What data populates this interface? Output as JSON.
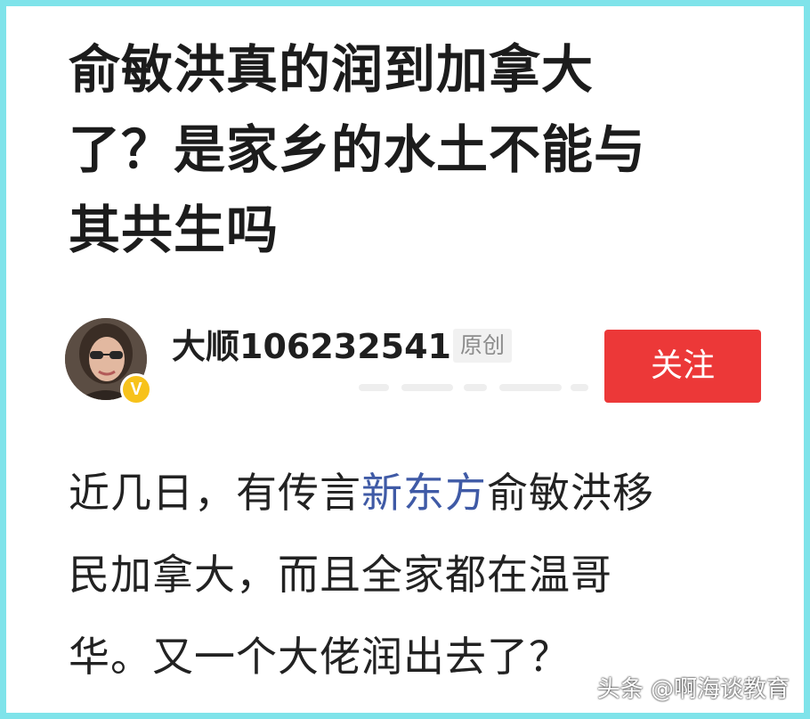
{
  "article": {
    "title_line1": "俞敏洪真的润到加拿大",
    "title_line2": "了？是家乡的水土不能与",
    "title_line3": "其共生吗"
  },
  "author": {
    "name": "大顺106232541",
    "original_label": "原创",
    "verified_mark": "V",
    "follow_label": "关注"
  },
  "content": {
    "line1_prefix": "近几日，有传言",
    "line1_link": "新东方",
    "line1_suffix": "俞敏洪移",
    "line2": "民加拿大，而且全家都在温哥",
    "line3": "华。又一个大佬润出去了？"
  },
  "watermark": {
    "text": "头条 @啊海谈教育"
  },
  "colors": {
    "border": "#7fe3ea",
    "follow_button": "#ec3838",
    "link": "#3f5aa6",
    "badge": "#f7c21b"
  },
  "icons": {
    "verified": "verified-v-badge-icon",
    "avatar": "user-avatar-photo"
  }
}
